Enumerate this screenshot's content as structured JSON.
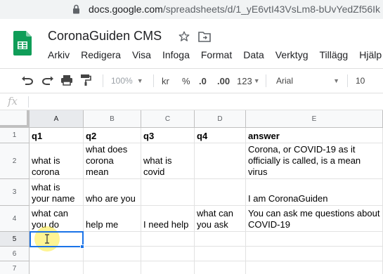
{
  "browser": {
    "url_host": "docs.google.com",
    "url_path": "/spreadsheets/d/1_yE6vtI43VsLm8-bUvYedZf56Ik"
  },
  "doc": {
    "title": "CoronaGuiden CMS"
  },
  "menu": [
    "Arkiv",
    "Redigera",
    "Visa",
    "Infoga",
    "Format",
    "Data",
    "Verktyg",
    "Tillägg",
    "Hjälp"
  ],
  "toolbar": {
    "zoom": "100%",
    "currency": "kr",
    "percent": "%",
    "decrease_decimals": ".0",
    "increase_decimals": ".00",
    "more_formats": "123",
    "font": "Arial",
    "font_size": "10"
  },
  "formula_bar": {
    "fx": "fx",
    "value": ""
  },
  "sheet": {
    "columns": [
      "A",
      "B",
      "C",
      "D",
      "E"
    ],
    "rows": [
      "1",
      "2",
      "3",
      "4",
      "5",
      "6",
      "7"
    ],
    "selected_cell": "A5",
    "cells": [
      [
        "q1",
        "q2",
        "q3",
        "q4",
        "answer"
      ],
      [
        "what is\ncorona",
        "what does\ncorona\nmean",
        "what is\ncovid",
        "",
        "Corona, or COVID-19 as it\nofficially is called, is a mean\nvirus"
      ],
      [
        "what is\nyour name",
        "who are you",
        "",
        "",
        "I am CoronaGuiden"
      ],
      [
        "what can\nyou do",
        "help me",
        "I need help",
        "what can\nyou ask",
        "You can ask me questions about\nCOVID-19"
      ],
      [
        "",
        "",
        "",
        "",
        ""
      ],
      [
        "",
        "",
        "",
        "",
        ""
      ],
      [
        "",
        "",
        "",
        "",
        ""
      ]
    ]
  },
  "colors": {
    "selection": "#1a73e8",
    "sheets_green": "#0f9d58",
    "cursor_highlight": "#ffeb3b"
  }
}
